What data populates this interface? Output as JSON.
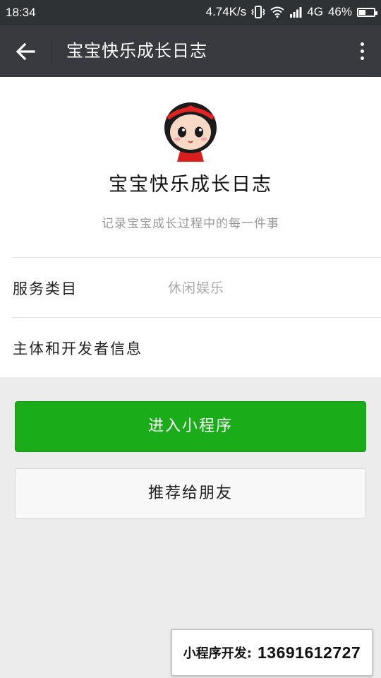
{
  "status_bar": {
    "time": "18:34",
    "network_speed": "4.74K/s",
    "network_type": "4G",
    "battery_percent": "46%",
    "battery_level": 0.46,
    "icons": [
      "vibrate-icon",
      "wifi-icon",
      "signal-icon",
      "battery-icon"
    ]
  },
  "header": {
    "title": "宝宝快乐成长日志",
    "back_icon": "arrow-left-icon",
    "menu_icon": "more-vertical-icon"
  },
  "app_info": {
    "name": "宝宝快乐成长日志",
    "description": "记录宝宝成长过程中的每一件事",
    "avatar": "cartoon-girl-avatar"
  },
  "details": {
    "category_label": "服务类目",
    "category_value": "休闲娱乐",
    "developer_label": "主体和开发者信息"
  },
  "actions": {
    "enter_label": "进入小程序",
    "recommend_label": "推荐给朋友"
  },
  "watermark": {
    "label": "小程序开发:",
    "phone": "13691612727"
  },
  "colors": {
    "primary_green": "#1aad19",
    "header_bg": "#393a3f",
    "status_bg": "#2f3234",
    "page_bg": "#ececec"
  }
}
